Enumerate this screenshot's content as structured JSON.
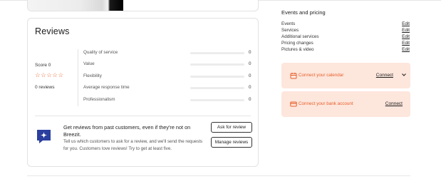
{
  "reviews": {
    "title": "Reviews",
    "score_label": "Score 0",
    "stars": "☆☆☆☆☆",
    "rating_stars": 0,
    "rating_out_of": 5,
    "reviews_count": "0 reviews",
    "metrics": [
      {
        "label": "Quality of service",
        "value": "0"
      },
      {
        "label": "Value",
        "value": "0"
      },
      {
        "label": "Flexibility",
        "value": "0"
      },
      {
        "label": "Average response time",
        "value": "0"
      },
      {
        "label": "Professionalism",
        "value": "0"
      }
    ],
    "cta": {
      "icon": "sparkle-chat-icon",
      "title": "Get reviews from past customers, even if they're not on Breezit.",
      "body": "Tell us which customers to ask for a review, and we'll send the requests for you. Customers love reviews! Try to get at least five.",
      "ask_button": "Ask for review",
      "manage_button": "Manage reviews"
    }
  },
  "events_pricing": {
    "title": "Events and pricing",
    "edit_label": "Edit",
    "rows": [
      {
        "label": "Events"
      },
      {
        "label": "Services"
      },
      {
        "label": "Additional services"
      },
      {
        "label": "Pricing changes"
      },
      {
        "label": "Pictures & video"
      }
    ]
  },
  "connect": {
    "calendar": {
      "icon": "calendar-icon",
      "label": "Connect your calendar",
      "action": "Connect"
    },
    "bank": {
      "icon": "credit-card-icon",
      "label": "Connect your bank account",
      "action": "Connect"
    }
  },
  "colors": {
    "accent": "#e8602c",
    "connect_bg": "#fde6dc",
    "cta_icon": "#2b3f9e"
  }
}
